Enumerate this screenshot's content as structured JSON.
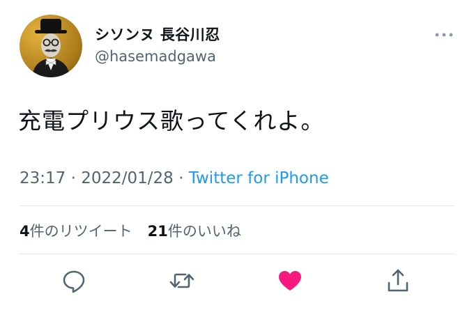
{
  "user": {
    "display_name": "シソンヌ 長谷川忍",
    "handle": "@hasemadgawa",
    "avatar": "avatar-man-bowler-hat"
  },
  "tweet": {
    "text": "充電プリウス歌ってくれよ。",
    "time": "23:17",
    "separator": "·",
    "date": "2022/01/28",
    "source": "Twitter for iPhone"
  },
  "stats": {
    "retweets_count": "4",
    "retweets_label": "件のリツイート",
    "likes_count": "21",
    "likes_label": "件のいいね"
  },
  "actions": [
    {
      "icon": "reply-icon"
    },
    {
      "icon": "retweet-icon"
    },
    {
      "icon": "heart-icon",
      "liked": true
    },
    {
      "icon": "share-icon"
    }
  ],
  "colors": {
    "link": "#1d9bf0",
    "secondary_text": "#536471",
    "like": "#f91880",
    "divider": "#e7e9ec"
  }
}
